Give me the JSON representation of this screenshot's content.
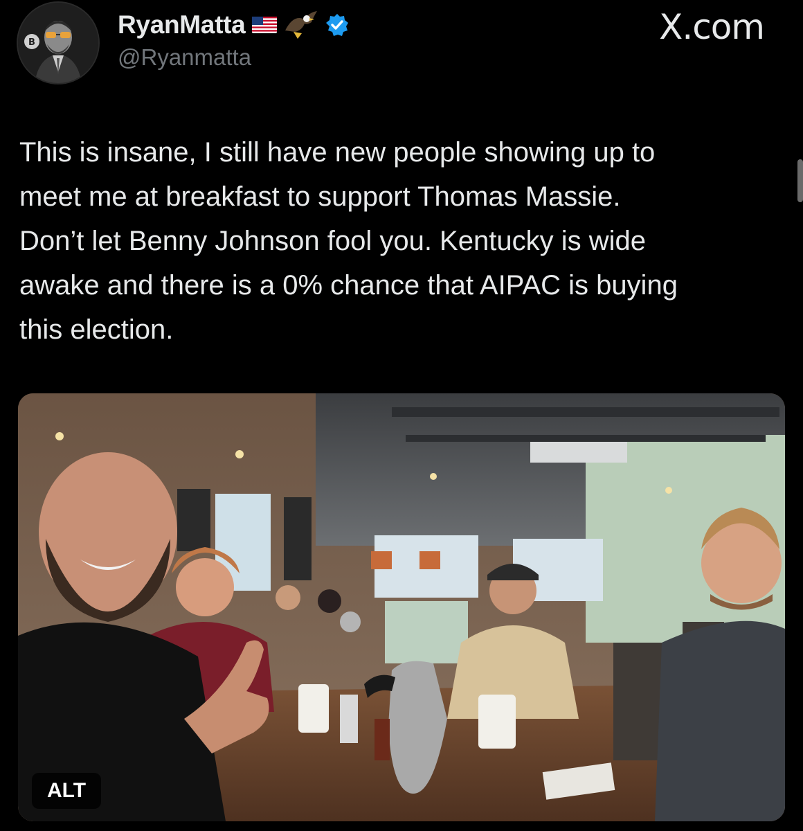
{
  "author": {
    "display_name": "RyanMatta",
    "handle": "@Ryanmatta",
    "avatar_icon": "avatar-icon",
    "name_emoji_icons": [
      "us-flag-icon",
      "eagle-icon"
    ],
    "verified_icon": "verified-badge-icon",
    "verified_color": "#1d9bf0"
  },
  "brand": {
    "label": "X.com"
  },
  "tweet": {
    "text": "This is insane, I still have new people showing up to\nmeet me at breakfast to support Thomas Massie.\nDon’t let Benny Johnson fool you. Kentucky is wide\nawake and there is a 0% chance that AIPAC is buying\nthis election."
  },
  "media": {
    "alt_badge": "ALT",
    "alt_badge_icon": "photo-image"
  },
  "colors": {
    "background": "#000000",
    "text_primary": "#e7e9ea",
    "text_secondary": "#71767b",
    "accent": "#1d9bf0"
  }
}
